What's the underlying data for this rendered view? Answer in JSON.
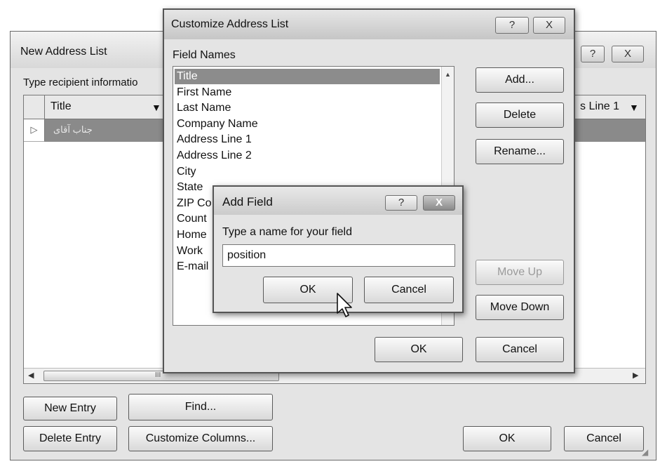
{
  "main_window": {
    "title": "New Address List",
    "instructions": "Type recipient informatio",
    "columns": [
      "Title",
      "s Line 1"
    ],
    "row_value": "جناب آقای",
    "buttons": {
      "new_entry": "New Entry",
      "find": "Find...",
      "delete_entry": "Delete Entry",
      "customize_columns": "Customize Columns...",
      "ok": "OK",
      "cancel": "Cancel"
    },
    "scroll_thumb_label": "III",
    "help_glyph": "?",
    "close_glyph": "X"
  },
  "customize_dialog": {
    "title": "Customize Address List",
    "field_names_label": "Field Names",
    "fields": [
      "Title",
      "First Name",
      "Last Name",
      "Company Name",
      "Address Line 1",
      "Address Line 2",
      "City",
      "State",
      "ZIP Co",
      "Count",
      "Home",
      "Work",
      "E-mail"
    ],
    "selected_index": 0,
    "buttons": {
      "add": "Add...",
      "delete": "Delete",
      "rename": "Rename...",
      "move_up": "Move Up",
      "move_down": "Move Down",
      "ok": "OK",
      "cancel": "Cancel"
    },
    "help_glyph": "?",
    "close_glyph": "X"
  },
  "add_field_dialog": {
    "title": "Add Field",
    "prompt": "Type a name for your field",
    "input_value": "position",
    "ok": "OK",
    "cancel": "Cancel",
    "help_glyph": "?",
    "close_glyph": "X"
  }
}
